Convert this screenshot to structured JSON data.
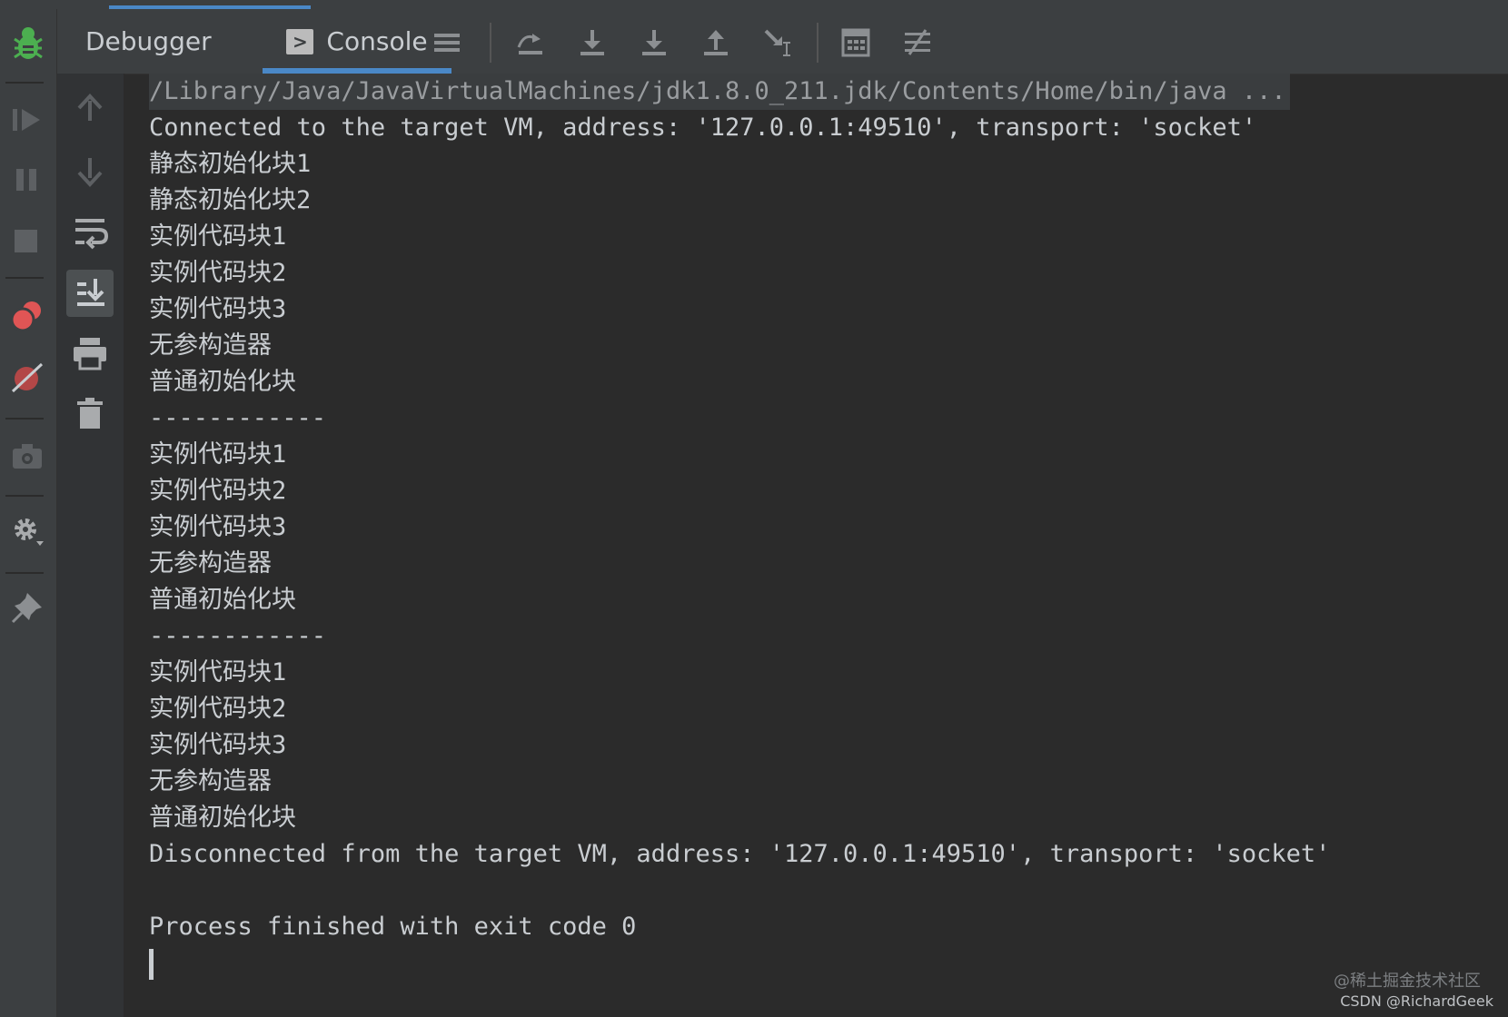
{
  "tabs": {
    "debugger": "Debugger",
    "console": "Console"
  },
  "toolbar_icons": [
    "threads-list-icon",
    "step-over-icon",
    "step-into-icon",
    "force-step-into-icon",
    "step-out-icon",
    "run-to-cursor-icon",
    "evaluate-expression-icon",
    "trace-settings-icon"
  ],
  "left_icons": [
    "debug-bug-icon",
    "resume-icon",
    "pause-icon",
    "stop-icon",
    "view-breakpoints-icon",
    "mute-breakpoints-icon",
    "camera-icon",
    "settings-icon",
    "pin-icon"
  ],
  "console_icons": [
    "up-arrow-icon",
    "down-arrow-icon",
    "soft-wrap-icon",
    "scroll-to-end-icon",
    "print-icon",
    "clear-all-icon"
  ],
  "console": {
    "command": "/Library/Java/JavaVirtualMachines/jdk1.8.0_211.jdk/Contents/Home/bin/java ...",
    "lines": [
      "Connected to the target VM, address: '127.0.0.1:49510', transport: 'socket'",
      "静态初始化块1",
      "静态初始化块2",
      "实例代码块1",
      "实例代码块2",
      "实例代码块3",
      "无参构造器",
      "普通初始化块",
      "------------",
      "实例代码块1",
      "实例代码块2",
      "实例代码块3",
      "无参构造器",
      "普通初始化块",
      "------------",
      "实例代码块1",
      "实例代码块2",
      "实例代码块3",
      "无参构造器",
      "普通初始化块",
      "Disconnected from the target VM, address: '127.0.0.1:49510', transport: 'socket'",
      "",
      "Process finished with exit code 0"
    ]
  },
  "watermark": {
    "line1": "@稀土掘金技术社区",
    "line2": "CSDN @RichardGeek"
  },
  "colors": {
    "accent": "#4a88c7",
    "background": "#2b2b2b",
    "toolbar": "#3c3f41",
    "text": "#c9cdd1",
    "bug_green": "#4caf50",
    "breakpoint_red": "#e05555"
  }
}
